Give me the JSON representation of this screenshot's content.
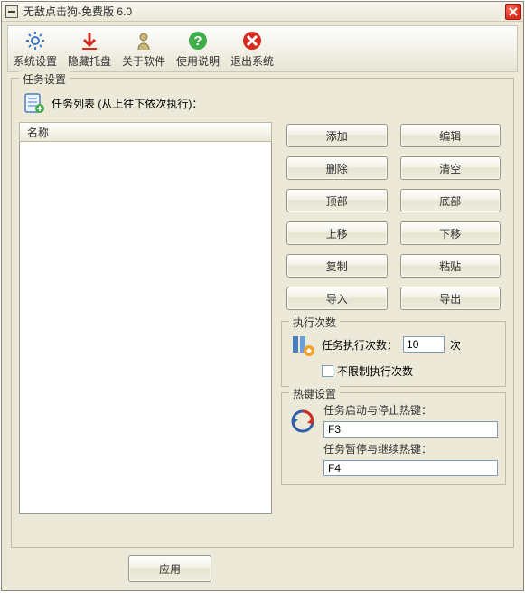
{
  "window": {
    "title": "无敌点击狗-免费版 6.0"
  },
  "toolbar": {
    "items": [
      {
        "label": "系统设置",
        "icon": "gear-icon"
      },
      {
        "label": "隐藏托盘",
        "icon": "download-arrow-icon"
      },
      {
        "label": "关于软件",
        "icon": "about-icon"
      },
      {
        "label": "使用说明",
        "icon": "help-icon"
      },
      {
        "label": "退出系统",
        "icon": "exit-icon"
      }
    ]
  },
  "task_group": {
    "title": "任务设置",
    "list_title": "任务列表 (从上往下依次执行)：",
    "column_header": "名称"
  },
  "buttons": {
    "add": "添加",
    "edit": "编辑",
    "delete": "删除",
    "clear": "清空",
    "top": "顶部",
    "bottom": "底部",
    "up": "上移",
    "down": "下移",
    "copy": "复制",
    "paste": "粘贴",
    "import": "导入",
    "export": "导出"
  },
  "exec": {
    "group_title": "执行次数",
    "label": "任务执行次数：",
    "value": "10",
    "unit": "次",
    "unlimited_label": "不限制执行次数",
    "unlimited_checked": false
  },
  "hotkey": {
    "group_title": "热键设置",
    "start_stop_label": "任务启动与停止热键：",
    "start_stop_value": "F3",
    "pause_resume_label": "任务暂停与继续热键：",
    "pause_resume_value": "F4"
  },
  "footer": {
    "apply": "应用"
  }
}
